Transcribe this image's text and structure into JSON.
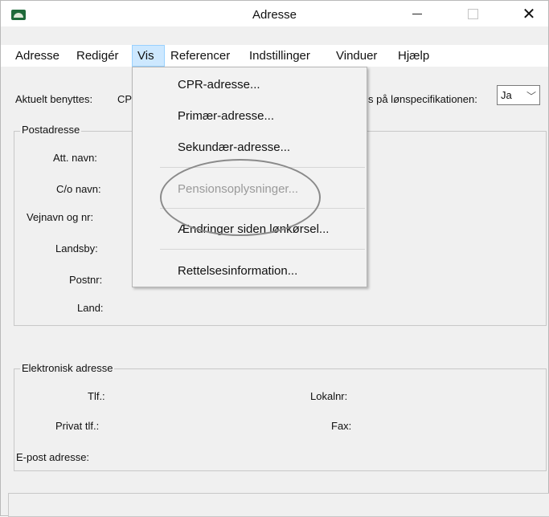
{
  "window": {
    "title": "Adresse",
    "minimize": "–",
    "maximize": "□",
    "close": "✕",
    "icon": "app-logo-icon"
  },
  "menu": [
    "Adresse",
    "Redigér",
    "Vis",
    "Referencer",
    "Indstillinger",
    "Vinduer",
    "Hjælp"
  ],
  "top": {
    "aktuelt_label": "Aktuelt benyttes:",
    "aktuelt_value": "CP",
    "lonspec_label": "s på lønspecifikationen:",
    "lonspec_value": "Ja",
    "combo_arrow": "chevron-down-icon"
  },
  "postadresse": {
    "title": "Postadresse",
    "fields": [
      "Att. navn:",
      "C/o navn:",
      "Vejnavn og nr:",
      "Landsby:",
      "Postnr:",
      "Land:"
    ]
  },
  "elektronisk": {
    "title": "Elektronisk adresse",
    "tlf": "Tlf.:",
    "privat_tlf": "Privat tlf.:",
    "epost": "E-post adresse:",
    "lokalnr": "Lokalnr:",
    "fax": "Fax:"
  },
  "vis_menu": {
    "items": [
      {
        "label": "CPR-adresse...",
        "enabled": true
      },
      {
        "label": "Primær-adresse...",
        "enabled": true
      },
      {
        "label": "Sekundær-adresse...",
        "enabled": true
      },
      {
        "label": "Pensionsoplysninger...",
        "enabled": false
      },
      {
        "label": "Ændringer siden lønkørsel...",
        "enabled": true
      },
      {
        "label": "Rettelsesinformation...",
        "enabled": true
      }
    ]
  },
  "colors": {
    "menu_active_bg": "#cde8ff",
    "disabled_text": "#9a9a9a",
    "annotation_circle": "#8a8a8a"
  }
}
